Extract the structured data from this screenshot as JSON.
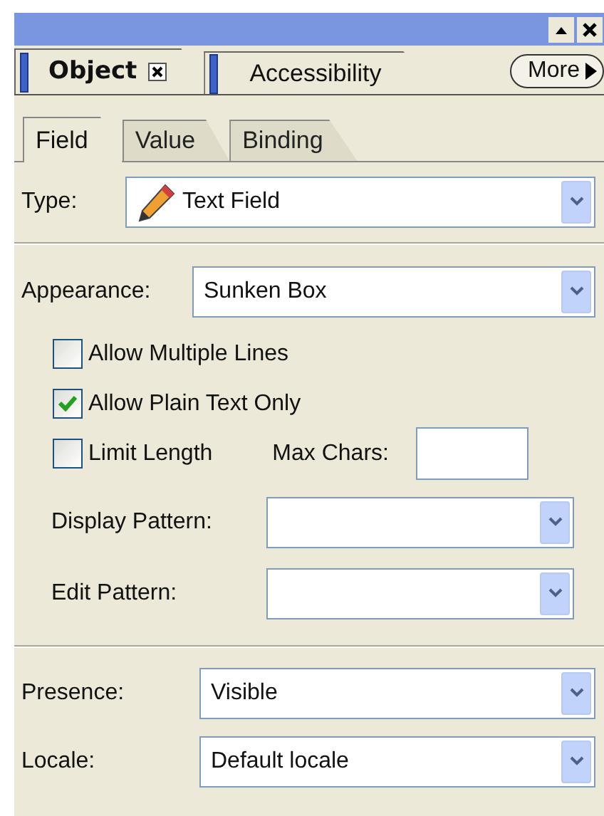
{
  "panel_tabs": [
    {
      "label": "Object",
      "selected": true,
      "closable": true
    },
    {
      "label": "Accessibility",
      "selected": false,
      "closable": false
    }
  ],
  "more_button": {
    "label": "More"
  },
  "sub_tabs": [
    {
      "label": "Field",
      "selected": true
    },
    {
      "label": "Value",
      "selected": false
    },
    {
      "label": "Binding",
      "selected": false
    }
  ],
  "type": {
    "label": "Type:",
    "value": "Text Field"
  },
  "appearance": {
    "label": "Appearance:",
    "value": "Sunken Box"
  },
  "options": [
    {
      "label": "Allow Multiple Lines",
      "checked": false
    },
    {
      "label": "Allow Plain Text Only",
      "checked": true
    },
    {
      "label": "Limit Length",
      "checked": false
    }
  ],
  "max_chars": {
    "label": "Max Chars:"
  },
  "display_pattern": {
    "label": "Display Pattern:"
  },
  "edit_pattern": {
    "label": "Edit Pattern:"
  },
  "presence": {
    "label": "Presence:",
    "value": "Visible"
  },
  "locale": {
    "label": "Locale:",
    "value": "Default locale"
  }
}
